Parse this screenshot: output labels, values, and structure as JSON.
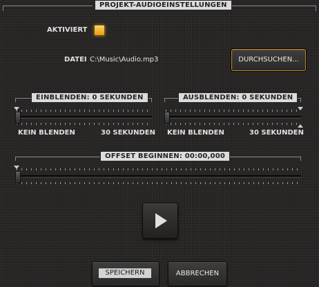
{
  "header": {
    "title": "PROJEKT-AUDIOEINSTELLUNGEN"
  },
  "activated": {
    "label": "AKTIVIERT",
    "checked": true
  },
  "file": {
    "label": "DATEI",
    "path": "C:\\Music\\Audio.mp3",
    "browse_label": "DURCHSUCHEN..."
  },
  "fade_in": {
    "title": "EINBLENDEN: 0 SEKUNDEN",
    "min_label": "KEIN BLENDEN",
    "max_label": "30 SEKUNDEN",
    "value": 0,
    "max": 30
  },
  "fade_out": {
    "title": "AUSBLENDEN: 0 SEKUNDEN",
    "min_label": "KEIN BLENDEN",
    "max_label": "30 SEKUNDEN",
    "value": 0,
    "max": 30
  },
  "offset": {
    "title": "OFFSET BEGINNEN: 00:00,000",
    "value": 0
  },
  "play": {
    "icon": "play-icon"
  },
  "footer": {
    "save_label": "SPEICHERN",
    "cancel_label": "ABBRECHEN"
  },
  "colors": {
    "accent": "#f0a21a",
    "background": "#272625",
    "header_bg": "#dcdcdc"
  }
}
